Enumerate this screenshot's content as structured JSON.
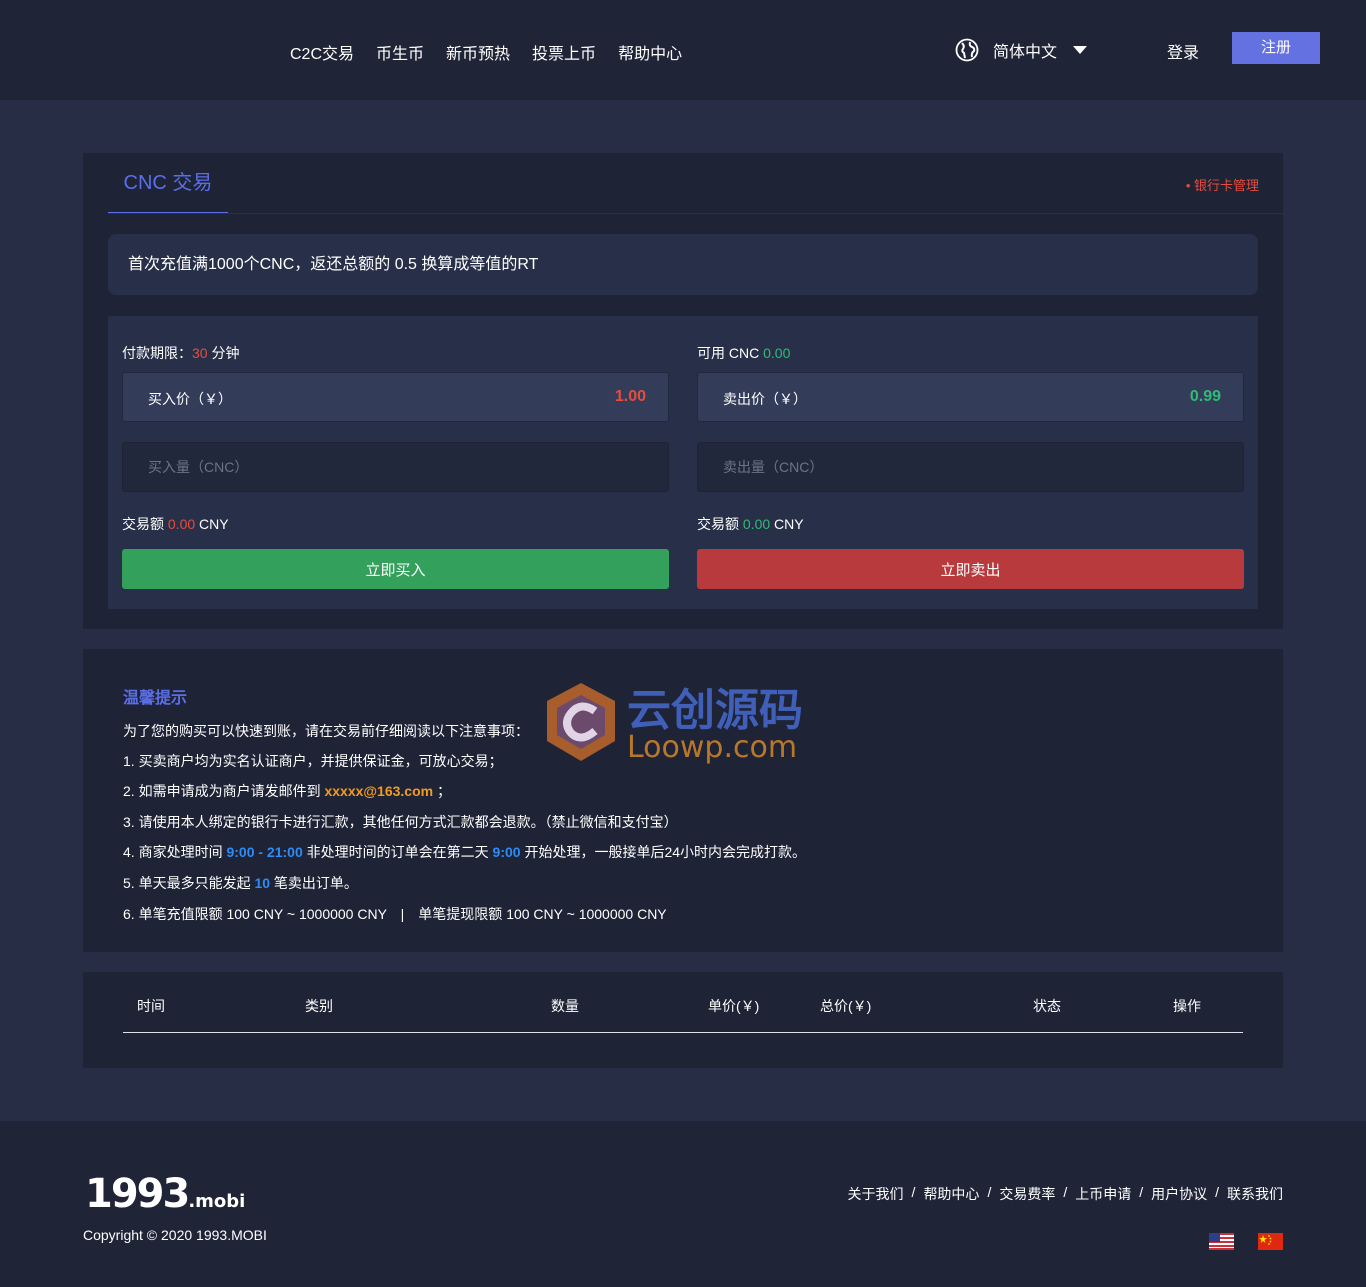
{
  "header": {
    "nav": [
      "C2C交易",
      "币生币",
      "新币预热",
      "投票上币",
      "帮助中心"
    ],
    "language": "简体中文",
    "login": "登录",
    "register": "注册"
  },
  "trade": {
    "tab": "CNC 交易",
    "bank_card_link": "• 银行卡管理",
    "notice": "首次充值满1000个CNC，返还总额的 0.5 换算成等值的RT",
    "buy": {
      "deadline_label": "付款期限：",
      "deadline_value": "30",
      "deadline_unit": "分钟",
      "price_label": "买入价（￥）",
      "price_value": "1.00",
      "qty_placeholder": "买入量（CNC）",
      "amount_label": "交易额",
      "amount_value": "0.00",
      "amount_unit": "CNY",
      "button": "立即买入"
    },
    "sell": {
      "available_label": "可用 CNC",
      "available_value": "0.00",
      "price_label": "卖出价（￥）",
      "price_value": "0.99",
      "qty_placeholder": "卖出量（CNC）",
      "amount_label": "交易额",
      "amount_value": "0.00",
      "amount_unit": "CNY",
      "button": "立即卖出"
    }
  },
  "tips": {
    "title": "温馨提示",
    "intro": "为了您的购买可以快速到账，请在交易前仔细阅读以下注意事项：",
    "line1": "1. 买卖商户均为实名认证商户，并提供保证金，可放心交易；",
    "line2_pre": "2. 如需申请成为商户请发邮件到 ",
    "line2_email": "xxxxx@163.com",
    "line2_post": " ；",
    "line3": "3. 请使用本人绑定的银行卡进行汇款，其他任何方式汇款都会退款。（禁止微信和支付宝）",
    "line4_pre": "4. 商家处理时间 ",
    "line4_time": "9:00 - 21:00",
    "line4_mid": " 非处理时间的订单会在第二天 ",
    "line4_time2": "9:00",
    "line4_post": " 开始处理，一般接单后24小时内会完成打款。",
    "line5_pre": "5. 单天最多只能发起 ",
    "line5_num": "10",
    "line5_post": " 笔卖出订单。",
    "line6": "6. 单笔充值限额 100 CNY ~ 1000000 CNY　|　单笔提现限额 100 CNY ~ 1000000 CNY",
    "watermark_cn": "云创源码",
    "watermark_en": "Loowp.com"
  },
  "records": {
    "columns": [
      "时间",
      "类别",
      "数量",
      "单价(￥)",
      "总价(￥)",
      "状态",
      "操作"
    ]
  },
  "footer": {
    "logo_main": "1993",
    "logo_suffix": ".mobi",
    "copyright": "Copyright © 2020 1993.MOBI",
    "links": [
      "关于我们",
      "帮助中心",
      "交易费率",
      "上币申请",
      "用户协议",
      "联系我们"
    ]
  },
  "colors": {
    "accent": "#5a6ee8",
    "buy": "#33a05b",
    "sell": "#b83a3d",
    "red_text": "#e74c3c",
    "green_text": "#2fbb75",
    "blue_text": "#2f8cf5",
    "orange_text": "#f29b21"
  }
}
